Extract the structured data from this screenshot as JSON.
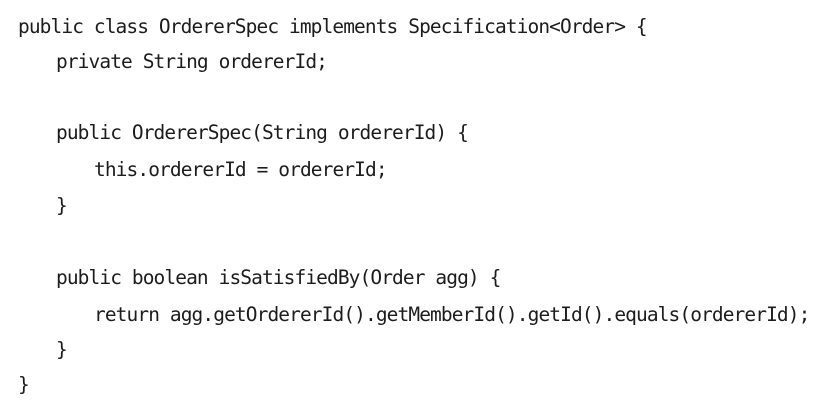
{
  "code": {
    "lines": [
      "public class OrdererSpec implements Specification<Order> {",
      "private String ordererId;",
      "",
      "public OrdererSpec(String ordererId) {",
      "this.ordererId = ordererId;",
      "}",
      "",
      "public boolean isSatisfiedBy(Order agg) {",
      "return agg.getOrdererId().getMemberId().getId().equals(ordererId);",
      "}",
      "}"
    ]
  }
}
